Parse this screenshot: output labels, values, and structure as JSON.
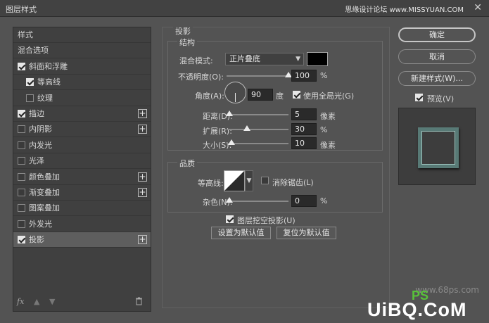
{
  "titlebar": {
    "title": "图层样式",
    "watermark": "思缘设计论坛 www.MISSYUAN.COM",
    "close": "✕"
  },
  "left": {
    "items": [
      {
        "label": "样式",
        "checkbox": null,
        "plus": false,
        "indent": 0,
        "active": false
      },
      {
        "label": "混合选项",
        "checkbox": null,
        "plus": false,
        "indent": 0,
        "active": false
      },
      {
        "label": "斜面和浮雕",
        "checkbox": true,
        "plus": false,
        "indent": 0,
        "active": false
      },
      {
        "label": "等高线",
        "checkbox": true,
        "plus": false,
        "indent": 1,
        "active": false
      },
      {
        "label": "纹理",
        "checkbox": false,
        "plus": false,
        "indent": 1,
        "active": false
      },
      {
        "label": "描边",
        "checkbox": true,
        "plus": true,
        "indent": 0,
        "active": false
      },
      {
        "label": "内阴影",
        "checkbox": false,
        "plus": true,
        "indent": 0,
        "active": false
      },
      {
        "label": "内发光",
        "checkbox": false,
        "plus": false,
        "indent": 0,
        "active": false
      },
      {
        "label": "光泽",
        "checkbox": false,
        "plus": false,
        "indent": 0,
        "active": false
      },
      {
        "label": "颜色叠加",
        "checkbox": false,
        "plus": true,
        "indent": 0,
        "active": false
      },
      {
        "label": "渐变叠加",
        "checkbox": false,
        "plus": true,
        "indent": 0,
        "active": false
      },
      {
        "label": "图案叠加",
        "checkbox": false,
        "plus": false,
        "indent": 0,
        "active": false
      },
      {
        "label": "外发光",
        "checkbox": false,
        "plus": false,
        "indent": 0,
        "active": false
      },
      {
        "label": "投影",
        "checkbox": true,
        "plus": true,
        "indent": 0,
        "active": true
      }
    ],
    "plus_symbol": "+",
    "footer": {
      "fx": "fx",
      "up": "▲",
      "down": "▼",
      "trash": "🗑"
    }
  },
  "main": {
    "section_title": "投影",
    "structure": {
      "title": "结构",
      "blend_mode_label": "混合模式:",
      "blend_mode_value": "正片叠底",
      "opacity_label": "不透明度(O):",
      "opacity_value": "100",
      "opacity_level": 1.0,
      "percent": "%",
      "angle_label": "角度(A):",
      "angle_value": "90",
      "degree": "度",
      "global_light_label": "使用全局光(G)",
      "global_light_checked": true,
      "distance_label": "距离(D):",
      "distance_value": "5",
      "distance_level": 0.0,
      "pixels": "像素",
      "spread_label": "扩展(R):",
      "spread_value": "30",
      "spread_level": 0.3,
      "size_label": "大小(S):",
      "size_value": "10",
      "size_level": 0.04
    },
    "quality": {
      "title": "品质",
      "contour_label": "等高线:",
      "anti_alias_label": "消除锯齿(L)",
      "anti_alias_checked": false,
      "noise_label": "杂色(N):",
      "noise_value": "0",
      "noise_level": 0.0
    },
    "knockout_label": "图层挖空投影(U)",
    "knockout_checked": true,
    "set_default": "设置为默认值",
    "reset_default": "复位为默认值"
  },
  "right": {
    "ok": "确定",
    "cancel": "取消",
    "new_style": "新建样式(W)...",
    "preview_label": "预览(V)",
    "preview_checked": true
  },
  "watermarks": {
    "site": "www.68ps.com",
    "logo": "UiBQ.CoM",
    "logo_ps": "PS"
  },
  "colors": {
    "shadow_swatch": "#000000",
    "preview_frame": "#587a76"
  }
}
